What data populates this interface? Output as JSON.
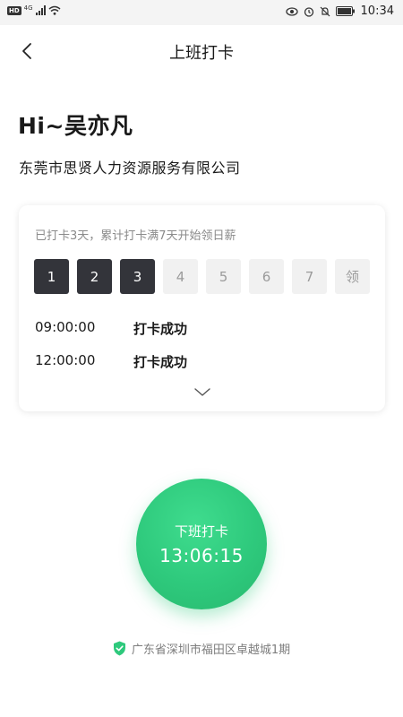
{
  "status_bar": {
    "network_badge": "HD",
    "network_type": "4G",
    "time": "10:34"
  },
  "header": {
    "title": "上班打卡"
  },
  "greeting": "Hi~吴亦凡",
  "company": "东莞市思贤人力资源服务有限公司",
  "card": {
    "hint": "已打卡3天，累计打卡满7天开始领日薪",
    "days": [
      {
        "label": "1",
        "done": true
      },
      {
        "label": "2",
        "done": true
      },
      {
        "label": "3",
        "done": true
      },
      {
        "label": "4",
        "done": false
      },
      {
        "label": "5",
        "done": false
      },
      {
        "label": "6",
        "done": false
      },
      {
        "label": "7",
        "done": false
      },
      {
        "label": "领",
        "done": false
      }
    ],
    "records": [
      {
        "time": "09:00:00",
        "status": "打卡成功"
      },
      {
        "time": "12:00:00",
        "status": "打卡成功"
      }
    ]
  },
  "checkout_button": {
    "label": "下班打卡",
    "time": "13:06:15"
  },
  "location": {
    "text": "广东省深圳市福田区卓越城1期"
  },
  "colors": {
    "accent": "#2ec97c",
    "day_done": "#33343a",
    "day_todo": "#f1f1f1"
  }
}
